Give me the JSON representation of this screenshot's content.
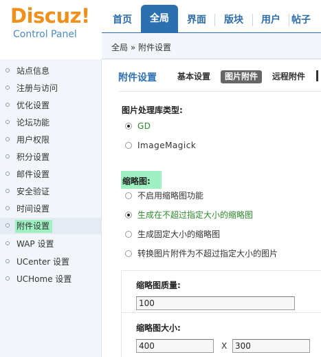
{
  "logo": {
    "brand": "Discuz",
    "bang": "!",
    "subtitle": "Control Panel"
  },
  "nav": {
    "tabs": [
      {
        "label": "首页"
      },
      {
        "label": "全局"
      },
      {
        "label": "界面"
      },
      {
        "label": "版块"
      },
      {
        "label": "用户"
      },
      {
        "label": "帖子"
      }
    ],
    "active_index": 1
  },
  "breadcrumb": {
    "text": "全局 » 附件设置"
  },
  "sidebar": {
    "items": [
      {
        "label": "站点信息"
      },
      {
        "label": "注册与访问"
      },
      {
        "label": "优化设置"
      },
      {
        "label": "论坛功能"
      },
      {
        "label": "用户权限"
      },
      {
        "label": "积分设置"
      },
      {
        "label": "邮件设置"
      },
      {
        "label": "安全验证"
      },
      {
        "label": "时间设置"
      },
      {
        "label": "附件设置"
      },
      {
        "label": "WAP 设置"
      },
      {
        "label": "UCenter 设置"
      },
      {
        "label": "UCHome 设置"
      }
    ],
    "active_index": 9
  },
  "main": {
    "title": "附件设置",
    "subtabs": [
      {
        "label": "基本设置"
      },
      {
        "label": "图片附件"
      },
      {
        "label": "远程附件"
      }
    ],
    "active_subtab": 1,
    "image_lib": {
      "label": "图片处理库类型:",
      "options": [
        {
          "label": "GD",
          "checked": true
        },
        {
          "label": "ImageMagick",
          "checked": false
        }
      ]
    },
    "thumbnail": {
      "label": "缩略图:",
      "options": [
        {
          "label": "不启用缩略图功能",
          "checked": false
        },
        {
          "label": "生成在不超过指定大小的缩略图",
          "checked": true
        },
        {
          "label": "生成固定大小的缩略图",
          "checked": false
        },
        {
          "label": "转换图片附件为不超过指定大小的图片",
          "checked": false
        }
      ]
    },
    "quality": {
      "label": "缩略图质量:",
      "value": "100"
    },
    "size": {
      "label": "缩略图大小:",
      "width": "400",
      "times": "X",
      "height": "300"
    }
  },
  "colors": {
    "accent": "#2d70b2",
    "logo": "#f0901c",
    "highlight": "#9ef2c2",
    "selected_option": "#2a8a2a"
  }
}
